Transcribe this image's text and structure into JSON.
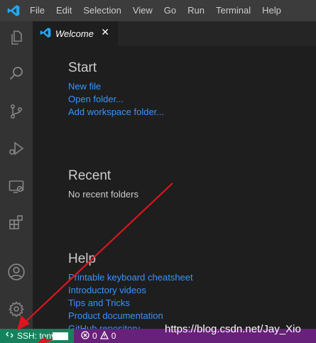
{
  "menubar": {
    "items": [
      "File",
      "Edit",
      "Selection",
      "View",
      "Go",
      "Run",
      "Terminal",
      "Help"
    ]
  },
  "activitybar": {
    "icons": [
      "explorer-icon",
      "search-icon",
      "source-control-icon",
      "run-debug-icon",
      "remote-explorer-icon",
      "extensions-icon",
      "account-icon",
      "settings-gear-icon"
    ]
  },
  "tabs": [
    {
      "label": "Welcome",
      "active": true
    }
  ],
  "welcome": {
    "start": {
      "title": "Start",
      "links": [
        "New file",
        "Open folder...",
        "Add workspace folder..."
      ]
    },
    "recent": {
      "title": "Recent",
      "empty_text": "No recent folders"
    },
    "help": {
      "title": "Help",
      "links": [
        "Printable keyboard cheatsheet",
        "Introductory videos",
        "Tips and Tricks",
        "Product documentation",
        "GitHub repository"
      ]
    }
  },
  "statusbar": {
    "remote_label": "SSH: tony",
    "errors": "0",
    "warnings": "0"
  },
  "watermark": "https://blog.csdn.net/Jay_Xio",
  "colors": {
    "menubar_bg": "#3c3c3c",
    "activitybar_bg": "#333333",
    "editor_bg": "#1e1e1e",
    "statusbar_bg": "#68217a",
    "remote_bg": "#16825d",
    "link": "#3794ff",
    "annotation_arrow": "#e0141e"
  }
}
